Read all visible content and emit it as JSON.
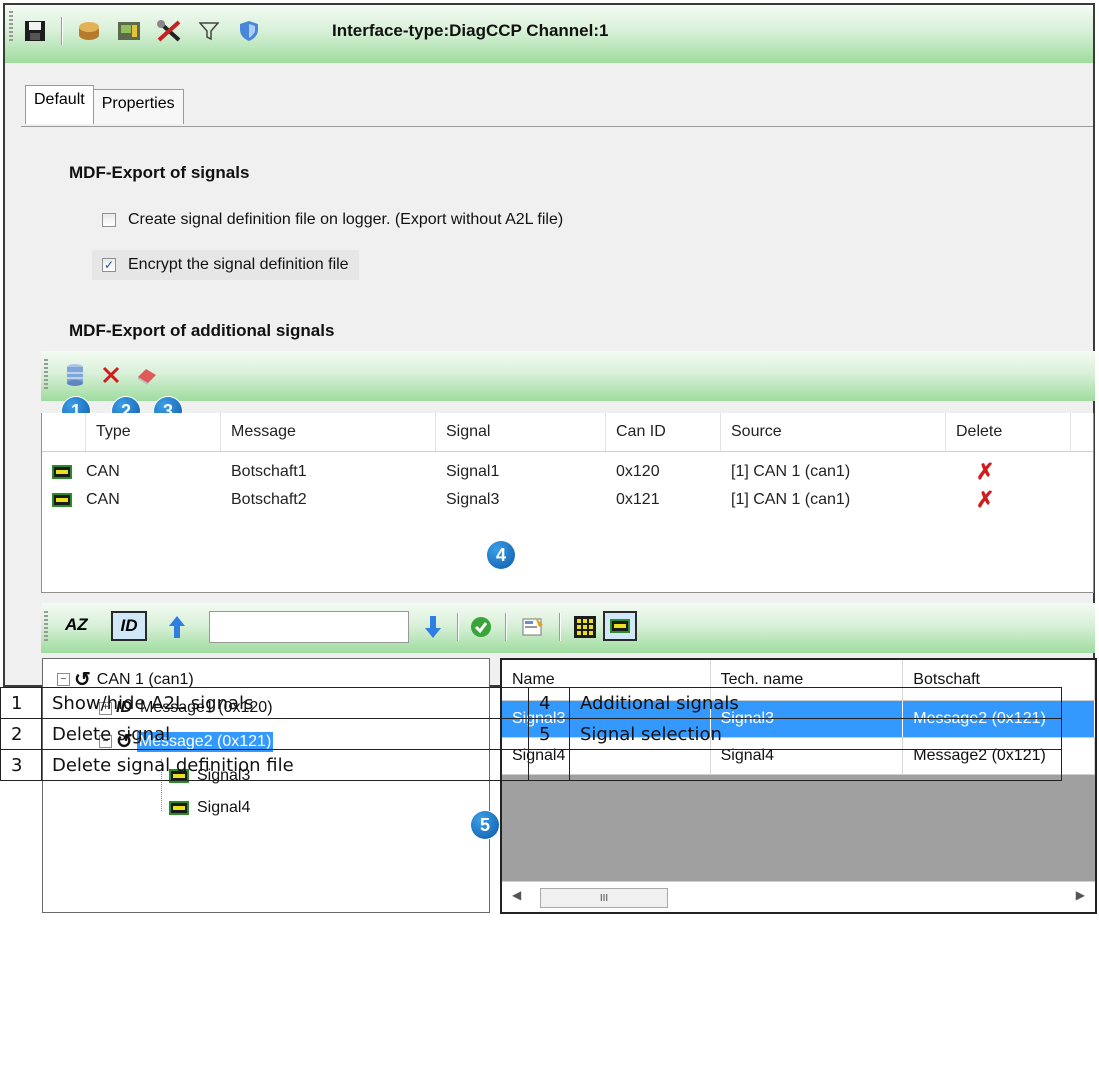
{
  "window": {
    "title": "Interface-type:DiagCCP Channel:1"
  },
  "toolbar": {
    "icons": [
      "save-icon",
      "package-icon",
      "device-icon",
      "tools-icon",
      "filter-icon",
      "shield-icon"
    ]
  },
  "tabs": [
    {
      "label": "Default",
      "active": true
    },
    {
      "label": "Properties",
      "active": false
    }
  ],
  "mdf_export": {
    "heading": "MDF-Export of signals",
    "option1": {
      "label": "Create signal definition file on logger. (Export without A2L file)",
      "checked": false
    },
    "option2": {
      "label": "Encrypt the signal definition file",
      "checked": true
    }
  },
  "additional": {
    "heading": "MDF-Export of additional signals",
    "toolbar_icons": [
      "database-icon",
      "delete-x-icon",
      "eraser-icon"
    ],
    "badges": [
      "1",
      "2",
      "3",
      "4",
      "5"
    ],
    "columns": [
      "Type",
      "Message",
      "Signal",
      "Can ID",
      "Source",
      "Delete"
    ],
    "rows": [
      {
        "type": "CAN",
        "message": "Botschaft1",
        "signal": "Signal1",
        "can_id": "0x120",
        "source": "[1] CAN  1 (can1)"
      },
      {
        "type": "CAN",
        "message": "Botschaft2",
        "signal": "Signal3",
        "can_id": "0x121",
        "source": "[1] CAN  1 (can1)"
      }
    ]
  },
  "selection_toolbar": {
    "sort_label": "AZ",
    "id_label": "ID",
    "search": {
      "value": "",
      "placeholder": ""
    }
  },
  "tree": {
    "root": "CAN  1 (can1)",
    "message1": "Message1 (0x120)",
    "message2": "Message2 (0x121)",
    "signal3": "Signal3",
    "signal4": "Signal4",
    "id_label": "ID"
  },
  "signal_table": {
    "columns": [
      "Name",
      "Tech. name",
      "Botschaft"
    ],
    "rows": [
      {
        "name": "Signal3",
        "tech": "Signal3",
        "botschaft": "Message2 (0x121)",
        "selected": true
      },
      {
        "name": "Signal4",
        "tech": "Signal4",
        "botschaft": "Message2 (0x121)",
        "selected": false
      }
    ],
    "scroll_thumb": "III"
  },
  "legend": [
    {
      "n1": "1",
      "t1": "Show/hide A2L signals",
      "n2": "4",
      "t2": "Additional signals"
    },
    {
      "n1": "2",
      "t1": "Delete signal",
      "n2": "5",
      "t2": "Signal selection"
    },
    {
      "n1": "3",
      "t1": "Delete signal definition file",
      "n2": "",
      "t2": ""
    }
  ],
  "colors": {
    "accent_green": "#9fdc9f",
    "selection_blue": "#3399ff",
    "badge_blue": "#0b5aa8",
    "delete_red": "#d21c1c"
  }
}
